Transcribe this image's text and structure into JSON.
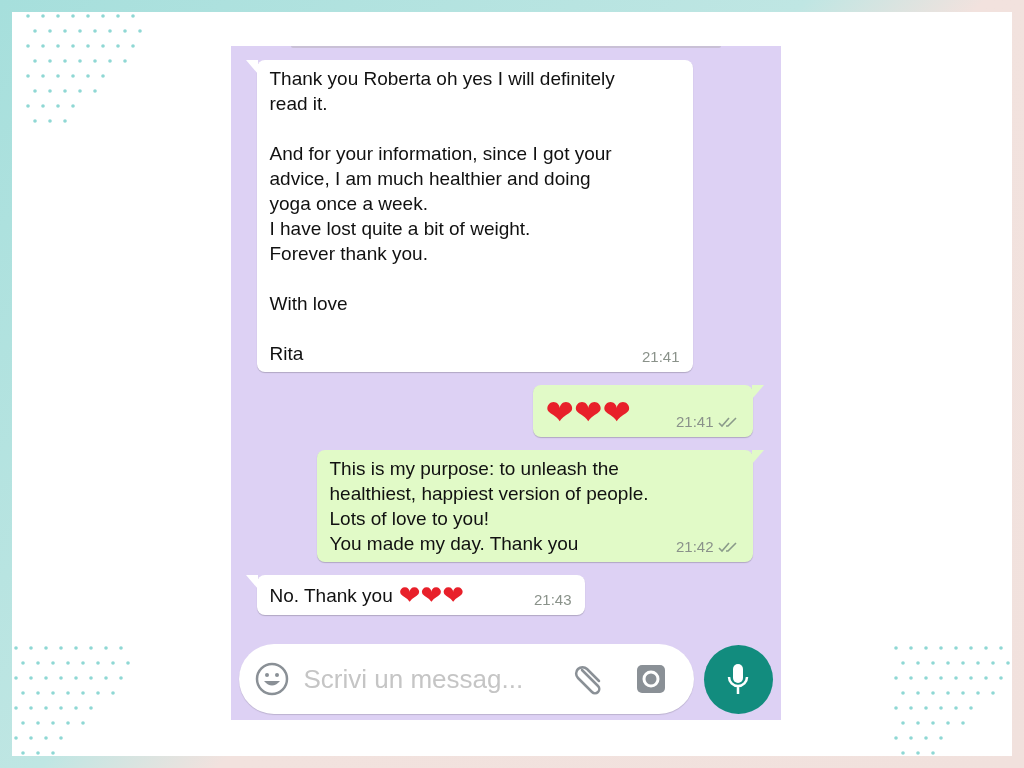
{
  "messages": [
    {
      "kind": "incoming",
      "text": "Thank you Roberta oh yes I will definitely read it.\n\nAnd for your information, since I got your advice, I am much healthier and doing yoga once a week.\nI have lost quite a bit of weight.\nForever thank you.\n\nWith love\n\nRita",
      "time": "21:41"
    },
    {
      "kind": "outgoing",
      "emoji": "❤❤❤",
      "time": "21:41",
      "read": false
    },
    {
      "kind": "outgoing",
      "text": "This is my purpose: to unleash the healthiest, happiest version of people.\nLots of love to you!\nYou made my day. Thank you",
      "time": "21:42",
      "read": false
    },
    {
      "kind": "incoming",
      "text": "No. Thank you",
      "emoji": "❤❤❤",
      "time": "21:43"
    }
  ],
  "composer": {
    "placeholder": "Scrivi un messag..."
  }
}
